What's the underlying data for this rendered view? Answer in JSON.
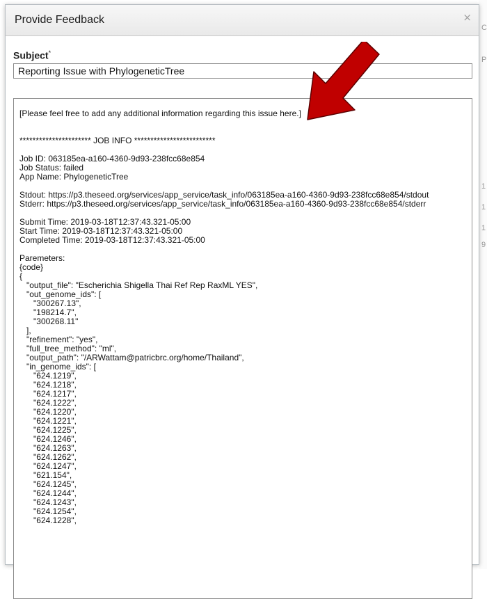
{
  "dialog": {
    "title": "Provide Feedback",
    "close_glyph": "×"
  },
  "subject": {
    "label": "Subject",
    "required_mark": "*",
    "value": "Reporting Issue with PhylogeneticTree"
  },
  "message": {
    "content": "[Please feel free to add any additional information regarding this issue here.]\n\n\n********************** JOB INFO *************************\n\nJob ID: 063185ea-a160-4360-9d93-238fcc68e854\nJob Status: failed\nApp Name: PhylogeneticTree\n\nStdout: https://p3.theseed.org/services/app_service/task_info/063185ea-a160-4360-9d93-238fcc68e854/stdout\nStderr: https://p3.theseed.org/services/app_service/task_info/063185ea-a160-4360-9d93-238fcc68e854/stderr\n\nSubmit Time: 2019-03-18T12:37:43.321-05:00\nStart Time: 2019-03-18T12:37:43.321-05:00\nCompleted Time: 2019-03-18T12:37:43.321-05:00\n\nParemeters:\n{code}\n{\n   \"output_file\": \"Escherichia Shigella Thai Ref Rep RaxML YES\",\n   \"out_genome_ids\": [\n      \"300267.13\",\n      \"198214.7\",\n      \"300268.11\"\n   ],\n   \"refinement\": \"yes\",\n   \"full_tree_method\": \"ml\",\n   \"output_path\": \"/ARWattam@patricbrc.org/home/Thailand\",\n   \"in_genome_ids\": [\n      \"624.1219\",\n      \"624.1218\",\n      \"624.1217\",\n      \"624.1222\",\n      \"624.1220\",\n      \"624.1221\",\n      \"624.1225\",\n      \"624.1246\",\n      \"624.1263\",\n      \"624.1262\",\n      \"624.1247\",\n      \"621.154\",\n      \"624.1245\",\n      \"624.1244\",\n      \"624.1243\",\n      \"624.1254\",\n      \"624.1228\","
  },
  "background": {
    "glyphs": [
      "C",
      "P",
      "1",
      "1",
      "1",
      "9"
    ]
  },
  "colors": {
    "arrow_fill": "#c00000",
    "arrow_stroke": "#5a0000"
  }
}
